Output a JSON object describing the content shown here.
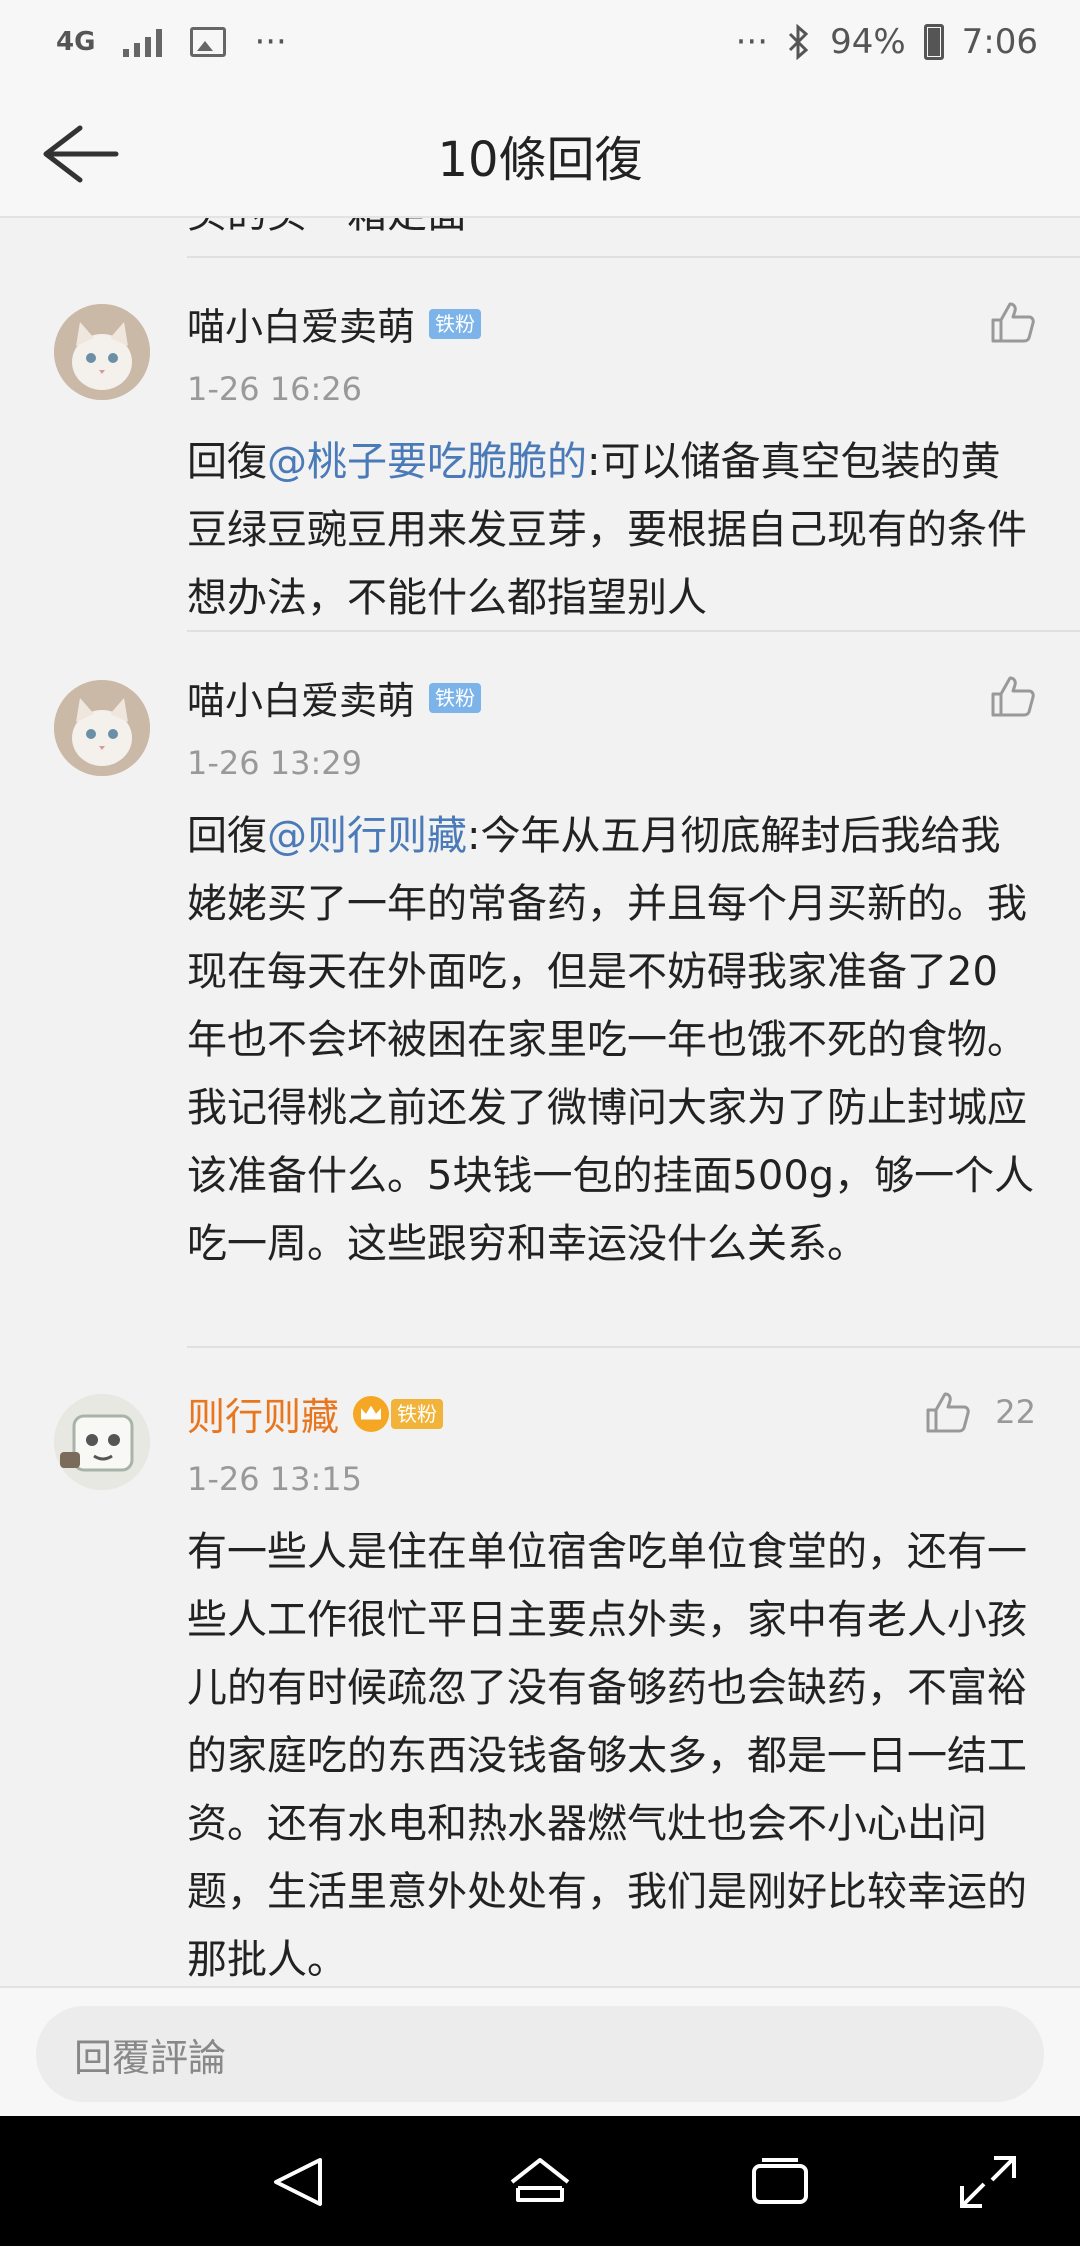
{
  "status_bar": {
    "network": "4G",
    "overflow": "···",
    "right_overflow": "···",
    "battery": "94%",
    "battery_level": 0.94,
    "time": "7:06",
    "icons": [
      "signal-icon",
      "image-icon",
      "bluetooth-icon",
      "battery-icon"
    ]
  },
  "header": {
    "title": "10條回復",
    "back_icon": "arrow-left-icon"
  },
  "feed": {
    "cut_off_text": "买的买一箱足面",
    "comments": [
      {
        "username": "喵小白爱卖萌",
        "badge": "铁粉",
        "timestamp": "1-26 16:26",
        "reply_prefix": "回復",
        "mention": "@桃子要吃脆脆的",
        "text": ":可以储备真空包装的黄豆绿豆豌豆用来发豆芽，要根据自己现有的条件想办法，不能什么都指望别人",
        "like_count": ""
      },
      {
        "username": "喵小白爱卖萌",
        "badge": "铁粉",
        "timestamp": "1-26 13:29",
        "reply_prefix": "回復",
        "mention": "@则行则藏",
        "text": ":今年从五月彻底解封后我给我姥姥买了一年的常备药，并且每个月买新的。我现在每天在外面吃，但是不妨碍我家准备了20年也不会坏被困在家里吃一年也饿不死的食物。我记得桃之前还发了微博问大家为了防止封城应该准备什么。5块钱一包的挂面500g，够一个人吃一周。这些跟穷和幸运没什么关系。",
        "like_count": ""
      },
      {
        "username": "则行则藏",
        "badge": "铁粉",
        "timestamp": "1-26 13:15",
        "reply_prefix": "",
        "mention": "",
        "text": "有一些人是住在单位宿舍吃单位食堂的，还有一些人工作很忙平日主要点外卖，家中有老人小孩儿的有时候疏忽了没有备够药也会缺药，不富裕的家庭吃的东西没钱备够太多，都是一日一结工资。还有水电和热水器燃气灶也会不小心出问题，生活里意外处处有，我们是刚好比较幸运的那批人。",
        "like_count": "22"
      }
    ]
  },
  "reply_bar": {
    "placeholder": "回覆評論"
  },
  "nav_bar": {
    "buttons": [
      "back-triangle-icon",
      "home-icon",
      "recents-icon",
      "expand-icon"
    ]
  },
  "colors": {
    "mention": "#4a7ab8",
    "gold_username": "#e8761e",
    "badge_blue": "#7cb4ea",
    "badge_gold": "#f2b33a",
    "timestamp": "#999999"
  }
}
